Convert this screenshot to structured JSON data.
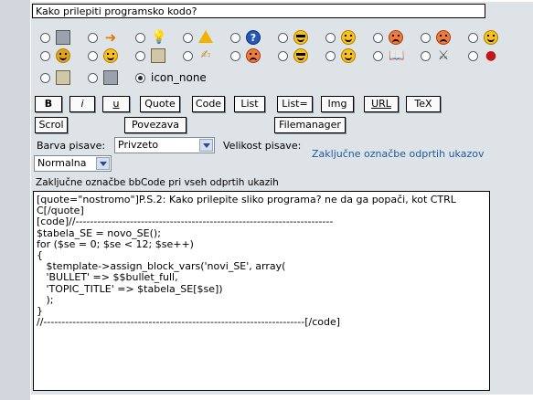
{
  "subject": {
    "value": "Kako prilepiti programsko kodo?"
  },
  "smilies": {
    "row1": [
      "phone-icon",
      "arrow-right-icon",
      "idea-bulb-icon",
      "warning-icon",
      "question-icon",
      "cool-smiley-icon",
      "happy-smiley-icon",
      "grin-smiley-icon",
      "sad-smiley-icon",
      "laugh-smiley-icon"
    ],
    "row2": [
      "surprised-smiley-icon",
      "neutral-smiley-icon",
      "document-icon",
      "thumbs-icon",
      "mad-smiley-icon",
      "wink-smiley-icon",
      "smile-smiley-icon",
      "book-icon",
      "swords-icon",
      "bomb-icon"
    ],
    "row3": [
      "scroll-icon",
      "building-icon"
    ],
    "icon_none_label": "icon_none"
  },
  "toolbar": {
    "b": "B",
    "i": "i",
    "u": "u",
    "quote": "Quote",
    "code": "Code",
    "list": "List",
    "list_eq": "List=",
    "img": "Img",
    "url": "URL",
    "tex": "TeX",
    "scroll": "Scrol",
    "link": "Povezava",
    "filemanager": "Filemanager"
  },
  "font": {
    "color_label": "Barva pisave:",
    "color_value": "Privzeto",
    "size_label": "Velikost pisave:",
    "size_value": "Normalna",
    "close_tags_link": "Zaključne označbe odprtih ukazov"
  },
  "hint": "Zaključne označbe bbCode pri vseh odprtih ukazih",
  "message": [
    "[quote=\"nostromo\"]P.S.2: Kako prilepite sliko programa? ne da ga popači, kot CTRL",
    "C[/quote]",
    "[code]//-----------------------------------------------------------------------",
    "$tabela_SE = novo_SE();",
    "for ($se = 0; $se < 12; $se++)",
    "{",
    "   $template->assign_block_vars('novi_SE', array(",
    "   'BULLET' => $$bullet_full,",
    "   'TOPIC_TITLE' => $tabela_SE[$se])",
    "   );",
    "}",
    "//------------------------------------------------------------------------[/code]"
  ]
}
